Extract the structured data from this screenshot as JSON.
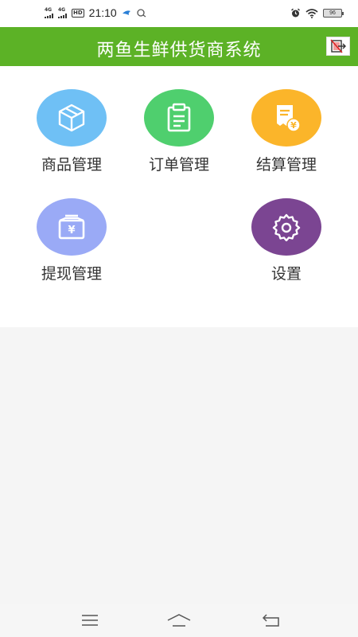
{
  "status_bar": {
    "signal_1": "4G",
    "signal_2": "4G",
    "hd_badge": "HD",
    "time": "21:10",
    "battery": "96"
  },
  "header": {
    "title": "两鱼生鲜供货商系统",
    "action_icon": "exit-icon"
  },
  "menu": {
    "items": [
      {
        "label": "商品管理",
        "icon": "box-icon",
        "color": "#6fc0f5"
      },
      {
        "label": "订单管理",
        "icon": "clipboard-icon",
        "color": "#4fcf6e"
      },
      {
        "label": "结算管理",
        "icon": "receipt-yen-icon",
        "color": "#fbb52a"
      },
      {
        "label": "提现管理",
        "icon": "cash-box-icon",
        "color": "#9aaaf6"
      },
      {
        "label": "设置",
        "icon": "gear-icon",
        "color": "#7b4592"
      }
    ]
  },
  "colors": {
    "header_bg": "#5cb226",
    "page_bg": "#f5f5f5"
  },
  "nav_bar": {
    "icons": [
      "menu-icon",
      "home-icon",
      "back-icon"
    ]
  }
}
